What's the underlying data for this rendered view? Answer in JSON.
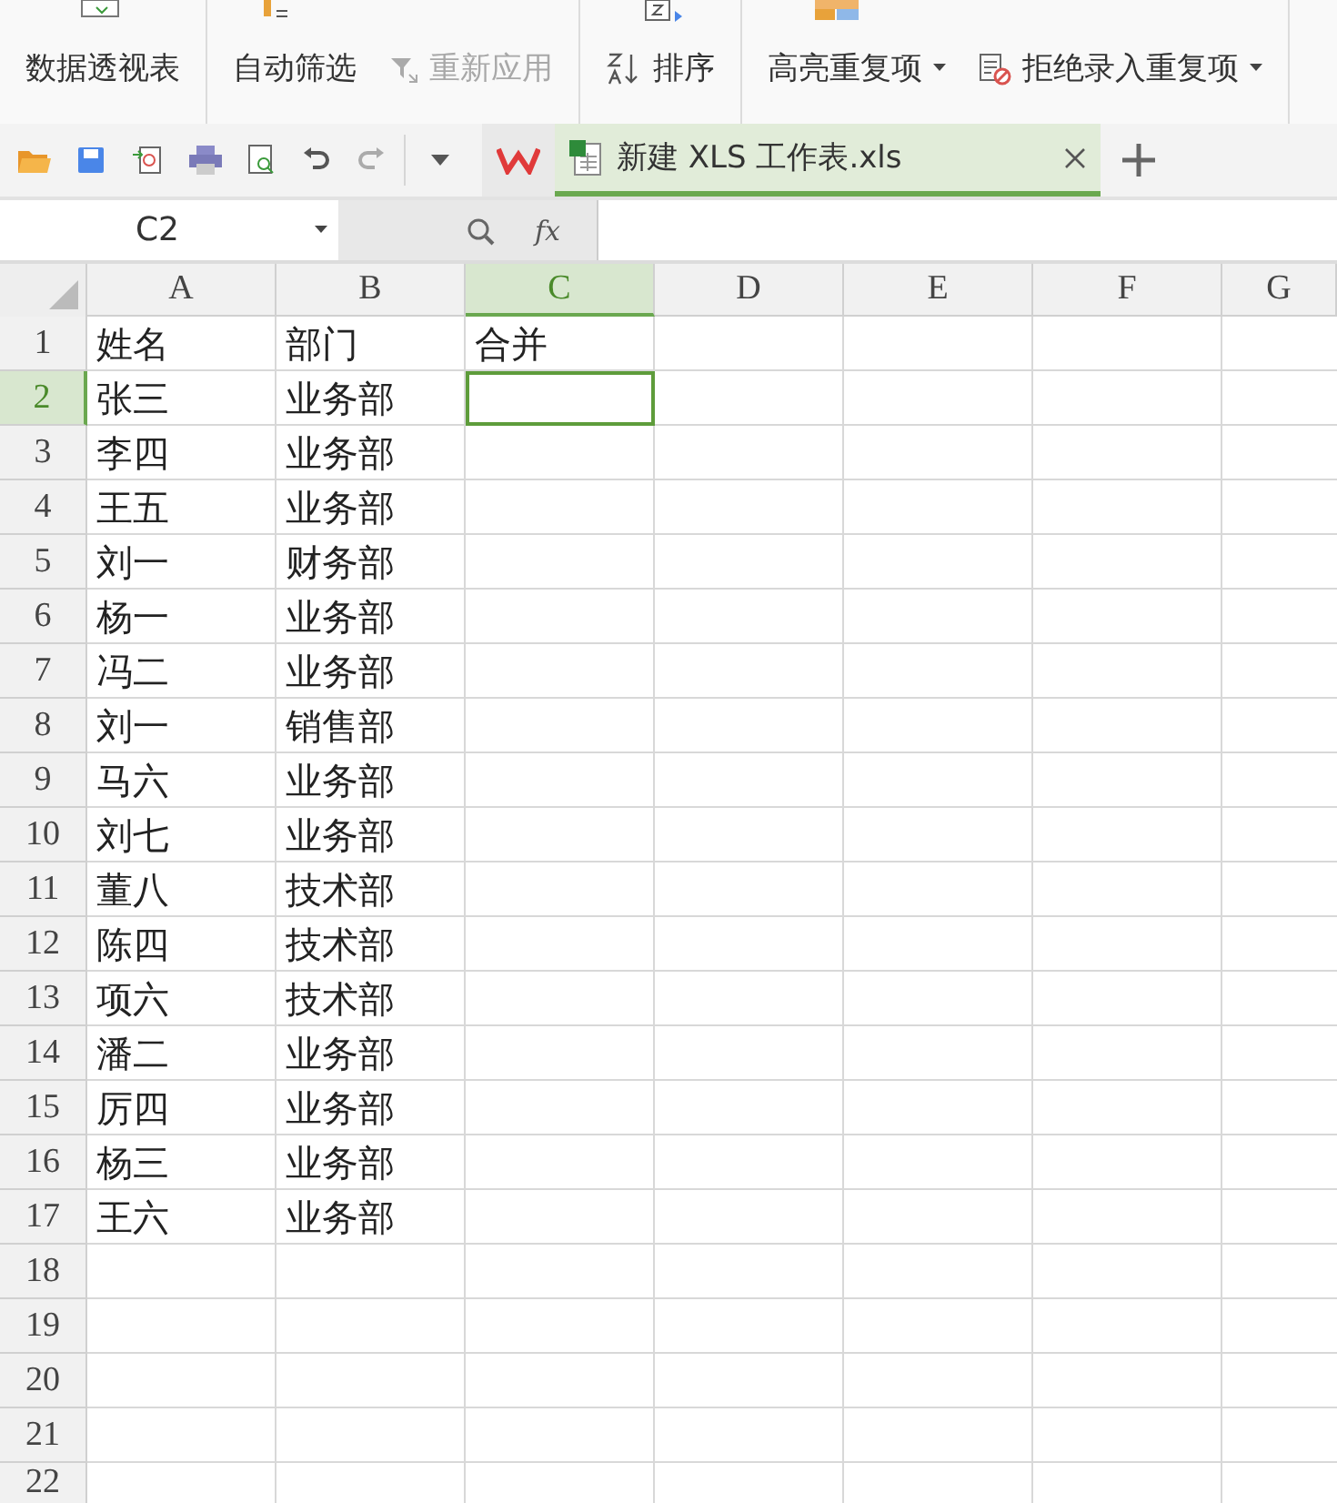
{
  "ribbon": {
    "groups": [
      {
        "items": [
          {
            "label": "数据透视表",
            "kind": "plain",
            "disabled": false,
            "dropdown": false
          }
        ]
      },
      {
        "items": [
          {
            "label": "自动筛选",
            "kind": "plain",
            "disabled": false,
            "dropdown": false
          },
          {
            "label": "重新应用",
            "kind": "filter",
            "disabled": true,
            "dropdown": false
          }
        ]
      },
      {
        "items": [
          {
            "label": "排序",
            "kind": "sort",
            "disabled": false,
            "dropdown": false
          }
        ]
      },
      {
        "items": [
          {
            "label": "高亮重复项",
            "kind": "plain",
            "disabled": false,
            "dropdown": true
          },
          {
            "label": "拒绝录入重复项",
            "kind": "block",
            "disabled": false,
            "dropdown": true
          }
        ]
      }
    ]
  },
  "tabs": [
    {
      "label": "新建 XLS 工作表.xls",
      "selected": true
    }
  ],
  "formula_bar": {
    "name_box": "C2",
    "fx": "fx"
  },
  "sheet": {
    "columns": [
      {
        "label": "A",
        "selected": false
      },
      {
        "label": "B",
        "selected": false
      },
      {
        "label": "C",
        "selected": true
      },
      {
        "label": "D",
        "selected": false
      },
      {
        "label": "E",
        "selected": false
      },
      {
        "label": "F",
        "selected": false
      },
      {
        "label": "G",
        "selected": false
      }
    ],
    "rows": [
      {
        "label": "1",
        "selected": false,
        "cells": [
          "姓名",
          "部门",
          "合并"
        ]
      },
      {
        "label": "2",
        "selected": true,
        "cells": [
          "张三",
          "业务部"
        ]
      },
      {
        "label": "3",
        "selected": false,
        "cells": [
          "李四",
          "业务部"
        ]
      },
      {
        "label": "4",
        "selected": false,
        "cells": [
          "王五",
          "业务部"
        ]
      },
      {
        "label": "5",
        "selected": false,
        "cells": [
          "刘一",
          "财务部"
        ]
      },
      {
        "label": "6",
        "selected": false,
        "cells": [
          "杨一",
          "业务部"
        ]
      },
      {
        "label": "7",
        "selected": false,
        "cells": [
          "冯二",
          "业务部"
        ]
      },
      {
        "label": "8",
        "selected": false,
        "cells": [
          "刘一",
          "销售部"
        ]
      },
      {
        "label": "9",
        "selected": false,
        "cells": [
          "马六",
          "业务部"
        ]
      },
      {
        "label": "10",
        "selected": false,
        "cells": [
          "刘七",
          "业务部"
        ]
      },
      {
        "label": "11",
        "selected": false,
        "cells": [
          "董八",
          "技术部"
        ]
      },
      {
        "label": "12",
        "selected": false,
        "cells": [
          "陈四",
          "技术部"
        ]
      },
      {
        "label": "13",
        "selected": false,
        "cells": [
          "项六",
          "技术部"
        ]
      },
      {
        "label": "14",
        "selected": false,
        "cells": [
          "潘二",
          "业务部"
        ]
      },
      {
        "label": "15",
        "selected": false,
        "cells": [
          "厉四",
          "业务部"
        ]
      },
      {
        "label": "16",
        "selected": false,
        "cells": [
          "杨三",
          "业务部"
        ]
      },
      {
        "label": "17",
        "selected": false,
        "cells": [
          "王六",
          "业务部"
        ]
      },
      {
        "label": "18",
        "selected": false,
        "cells": []
      },
      {
        "label": "19",
        "selected": false,
        "cells": []
      },
      {
        "label": "20",
        "selected": false,
        "cells": []
      },
      {
        "label": "21",
        "selected": false,
        "cells": []
      },
      {
        "label": "22",
        "selected": false,
        "cells": []
      }
    ]
  }
}
